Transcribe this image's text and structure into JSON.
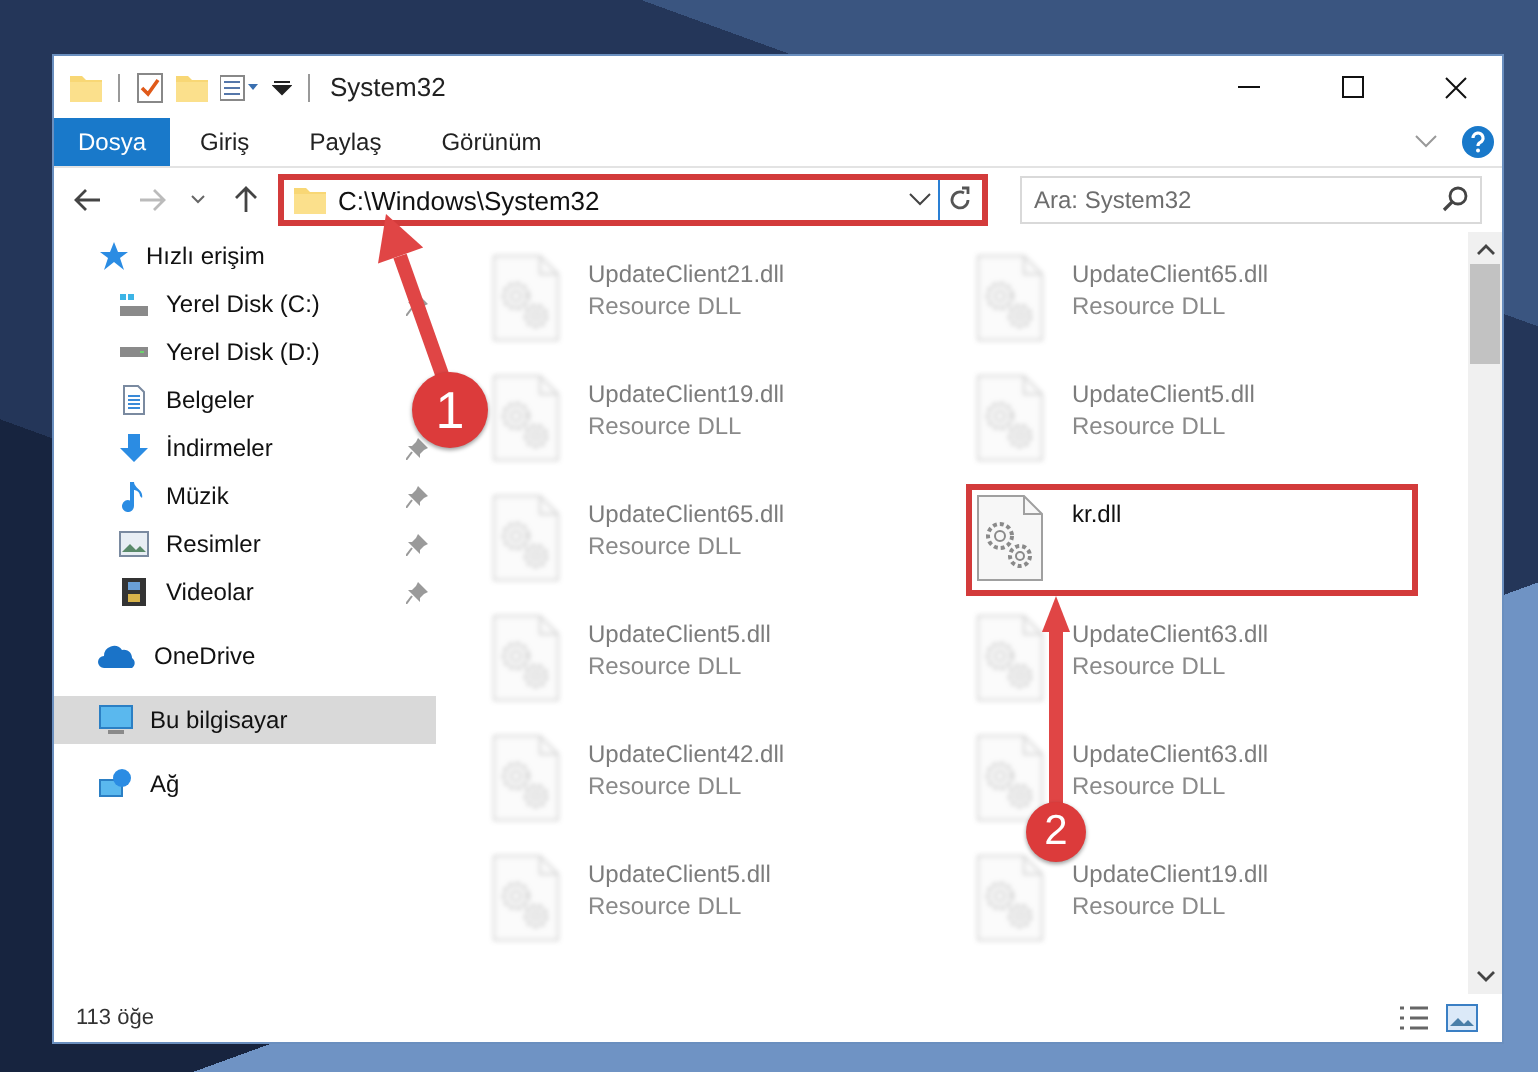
{
  "window": {
    "title": "System32"
  },
  "ribbon_tabs": [
    {
      "label": "Dosya",
      "kind": "file"
    },
    {
      "label": "Giriş",
      "kind": "tab"
    },
    {
      "label": "Paylaş",
      "kind": "tab"
    },
    {
      "label": "Görünüm",
      "kind": "tab"
    }
  ],
  "address": {
    "path": "C:\\Windows\\System32",
    "highlighted": true
  },
  "search": {
    "placeholder": "Ara: System32"
  },
  "sidebar": {
    "items": [
      {
        "label": "Hızlı erişim",
        "kind": "star",
        "selected": false,
        "pinned": false,
        "children": [
          {
            "label": "Yerel Disk (C:)",
            "kind": "drive_c",
            "selected": false,
            "pinned": true
          },
          {
            "label": "Yerel Disk (D:)",
            "kind": "drive",
            "selected": false,
            "pinned": false
          },
          {
            "label": "Belgeler",
            "kind": "documents",
            "selected": false,
            "pinned": false
          },
          {
            "label": "İndirmeler",
            "kind": "downloads",
            "selected": false,
            "pinned": true
          },
          {
            "label": "Müzik",
            "kind": "music",
            "selected": false,
            "pinned": true
          },
          {
            "label": "Resimler",
            "kind": "pictures",
            "selected": false,
            "pinned": true
          },
          {
            "label": "Videolar",
            "kind": "videos",
            "selected": false,
            "pinned": true
          }
        ]
      },
      {
        "label": "OneDrive",
        "kind": "cloud",
        "selected": false,
        "pinned": false
      },
      {
        "label": "Bu bilgisayar",
        "kind": "computer",
        "selected": true,
        "pinned": false
      },
      {
        "label": "Ağ",
        "kind": "network",
        "selected": false,
        "pinned": false
      }
    ]
  },
  "files": [
    {
      "name": "UpdateClient21.dll",
      "type": "Resource DLL",
      "blurred": true,
      "highlighted": false
    },
    {
      "name": "UpdateClient65.dll",
      "type": "Resource DLL",
      "blurred": true,
      "highlighted": false
    },
    {
      "name": "UpdateClient19.dll",
      "type": "Resource DLL",
      "blurred": true,
      "highlighted": false
    },
    {
      "name": "UpdateClient5.dll",
      "type": "Resource DLL",
      "blurred": true,
      "highlighted": false
    },
    {
      "name": "UpdateClient65.dll",
      "type": "Resource DLL",
      "blurred": true,
      "highlighted": false
    },
    {
      "name": "kr.dll",
      "blurred": false,
      "highlighted": true
    },
    {
      "name": "UpdateClient5.dll",
      "type": "Resource DLL",
      "blurred": true,
      "highlighted": false
    },
    {
      "name": "UpdateClient63.dll",
      "type": "Resource DLL",
      "blurred": true,
      "highlighted": false
    },
    {
      "name": "UpdateClient42.dll",
      "type": "Resource DLL",
      "blurred": true,
      "highlighted": false
    },
    {
      "name": "UpdateClient63.dll",
      "type": "Resource DLL",
      "blurred": true,
      "highlighted": false
    },
    {
      "name": "UpdateClient5.dll",
      "type": "Resource DLL",
      "blurred": true,
      "highlighted": false
    },
    {
      "name": "UpdateClient19.dll",
      "type": "Resource DLL",
      "blurred": true,
      "highlighted": false
    }
  ],
  "status_bar": {
    "item_count": "113 öğe"
  },
  "annotations": [
    {
      "label": "1"
    },
    {
      "label": "2"
    }
  ]
}
